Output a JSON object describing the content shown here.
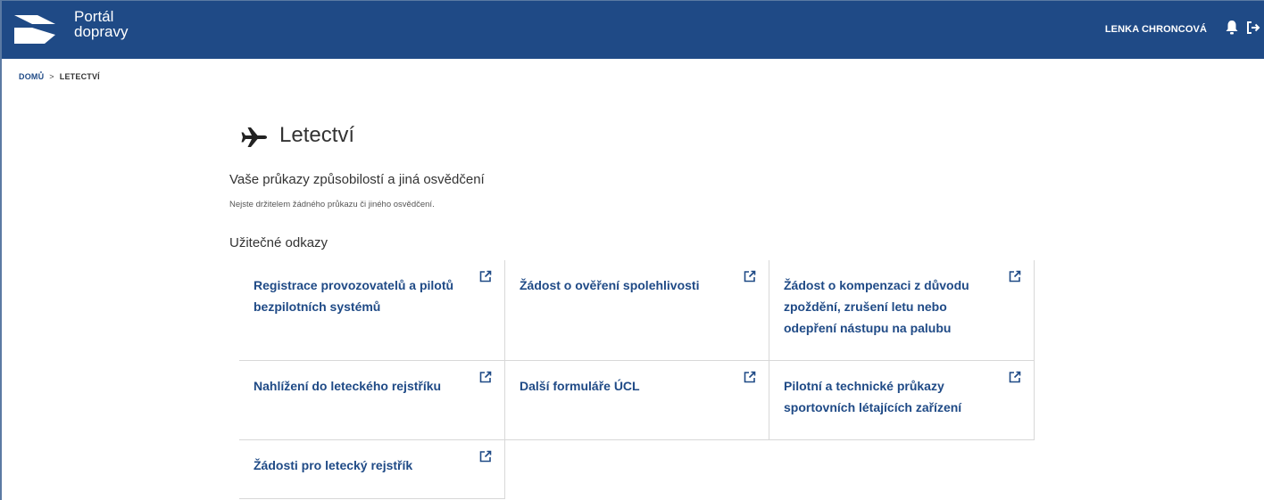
{
  "header": {
    "logo_line1": "Portál",
    "logo_line2": "dopravy",
    "user_name": "LENKA CHRONCOVÁ",
    "bell_icon": "bell-icon",
    "logout_icon": "logout-icon",
    "color": "#1f4a86"
  },
  "breadcrumb": {
    "home": "DOMŮ",
    "separator": ">",
    "current": "LETECTVÍ"
  },
  "page": {
    "title": "Letectví",
    "title_icon": "airplane-icon",
    "section_licenses": "Vaše průkazy způsobilostí a jiná osvědčení",
    "no_licenses_note": "Nejste držitelem žádného průkazu či jiného osvědčení.",
    "section_links": "Užitečné odkazy"
  },
  "links": [
    "Registrace provozovatelů a pilotů bezpilotních systémů",
    "Žádost o ověření spolehlivosti",
    "Žádost o kompenzaci z důvodu zpoždění, zrušení letu nebo odepření nástupu na palubu",
    "Nahlížení do leteckého rejstříku",
    "Další formuláře ÚCL",
    "Pilotní a technické průkazy sportovních létajících zařízení",
    "Žádosti pro letecký rejstřík"
  ]
}
